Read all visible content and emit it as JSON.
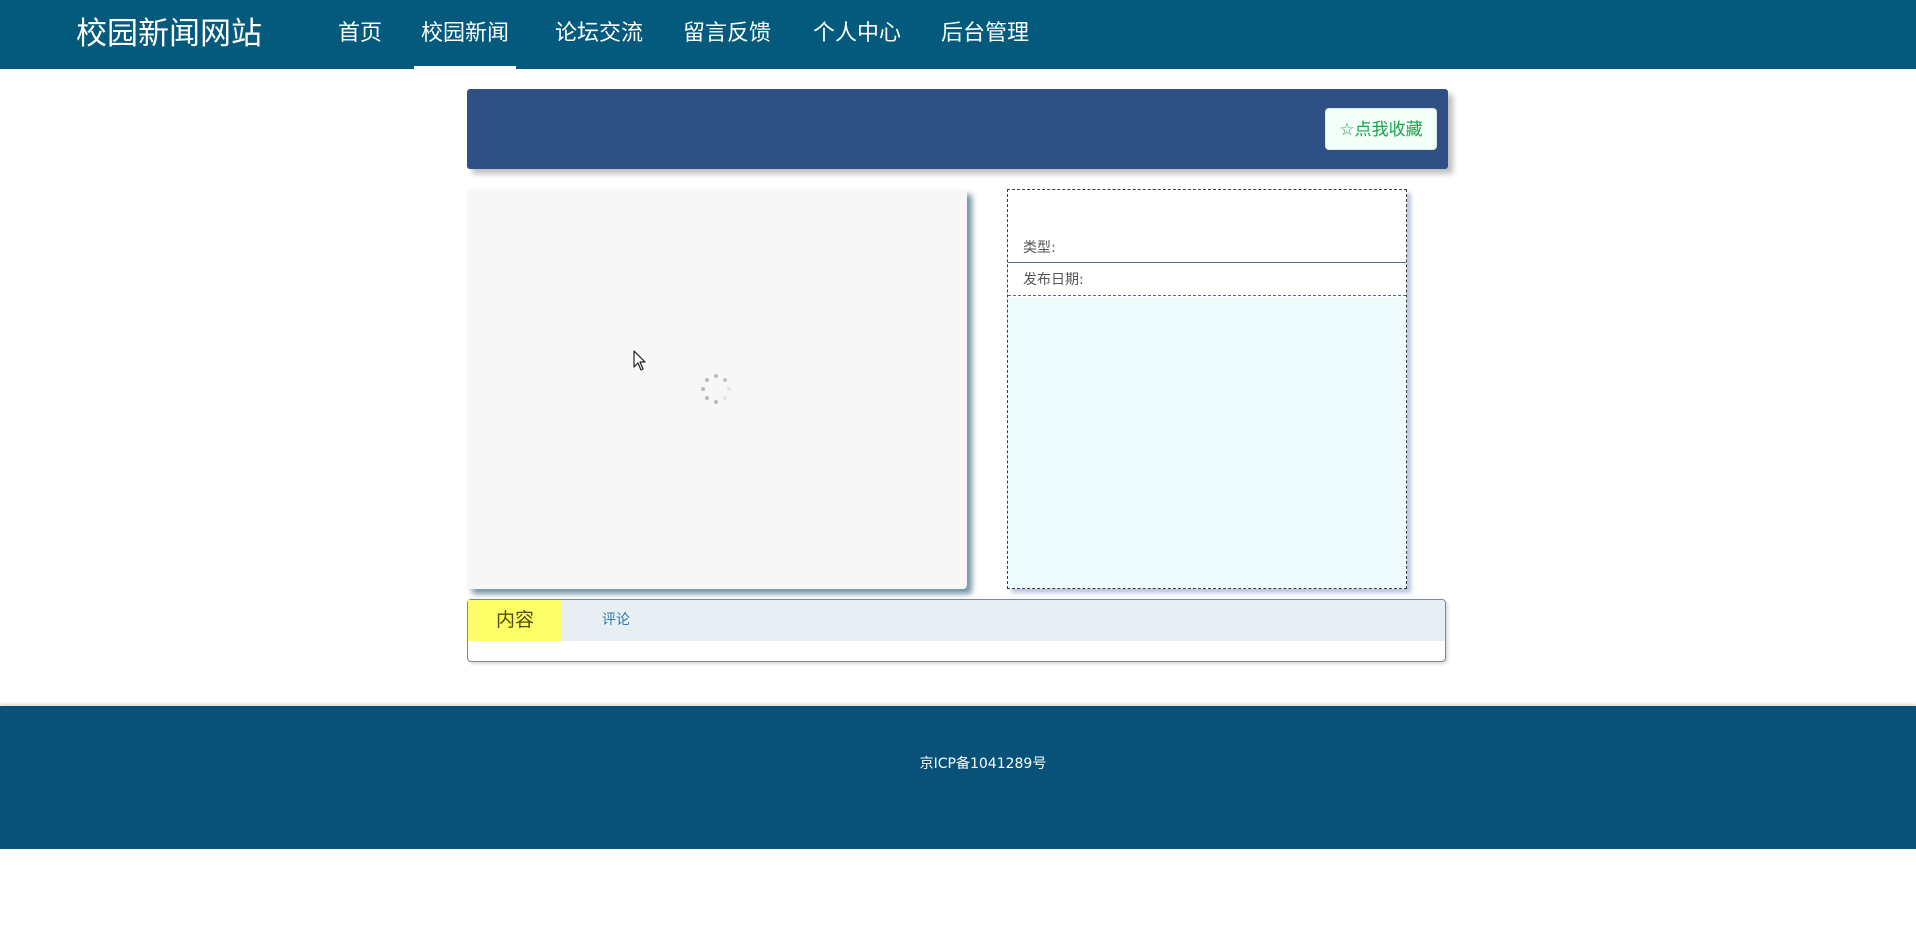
{
  "site": {
    "title": "校园新闻网站"
  },
  "nav": {
    "items": [
      {
        "label": "首页"
      },
      {
        "label": "校园新闻",
        "active": true
      },
      {
        "label": "论坛交流"
      },
      {
        "label": "留言反馈"
      },
      {
        "label": "个人中心"
      },
      {
        "label": "后台管理"
      }
    ]
  },
  "banner": {
    "favorite_label": "☆点我收藏"
  },
  "info": {
    "type_label": "类型:",
    "date_label": "发布日期:"
  },
  "tabs": [
    {
      "label": "内容",
      "active": true
    },
    {
      "label": "评论"
    }
  ],
  "footer": {
    "icp": "京ICP备1041289号"
  },
  "colors": {
    "header": "#045a7c",
    "banner": "#2f5085",
    "footer": "#08527a",
    "active_tab": "#fdfd67",
    "favorite_text": "#1aa34a"
  }
}
